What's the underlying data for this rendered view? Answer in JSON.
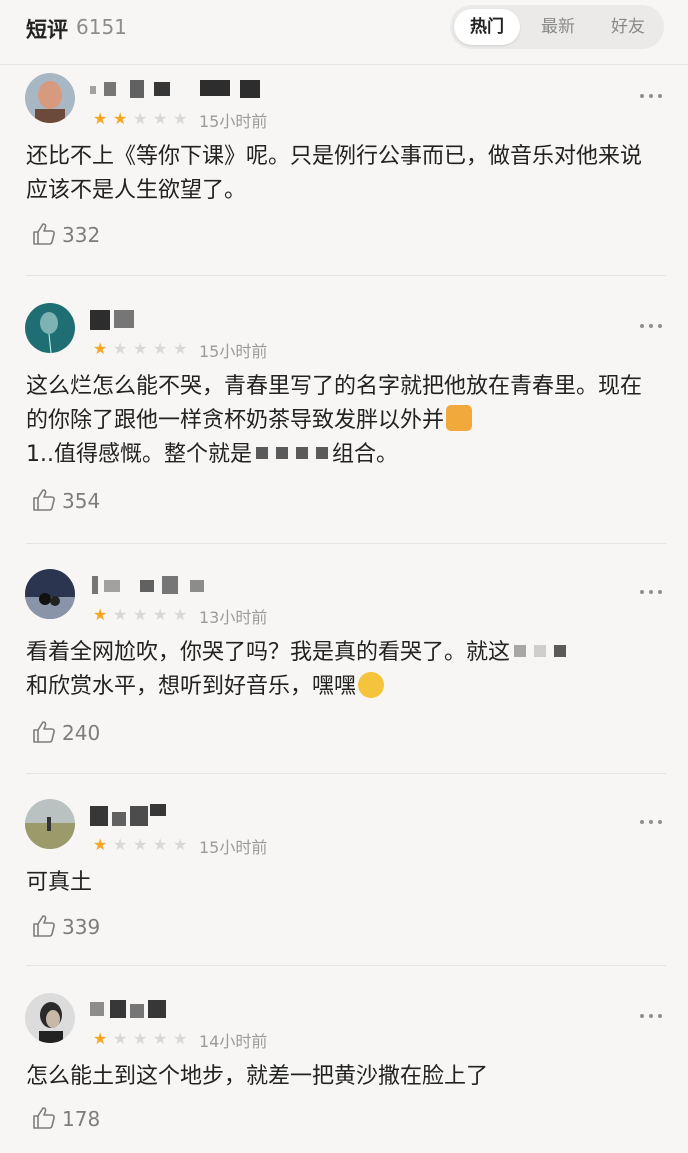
{
  "header": {
    "title": "短评",
    "count": "6151",
    "tabs": [
      {
        "label": "热门",
        "active": true
      },
      {
        "label": "最新",
        "active": false
      },
      {
        "label": "好友",
        "active": false
      }
    ]
  },
  "colors": {
    "star_filled": "#f5a623",
    "star_empty": "#d8d8d8",
    "background": "#f7f6f4"
  },
  "comments": [
    {
      "rating": 2,
      "time": "15小时前",
      "text": "还比不上《等你下课》呢。只是例行公事而已，做音乐对他来说应该不是人生欲望了。",
      "likes": "332"
    },
    {
      "rating": 1,
      "time": "15小时前",
      "text_1": "这么烂怎么能不哭，青春里写了的名字就把他放在青春里。现在的你除了跟他一样贪杯奶茶导致发胖以外并",
      "text_2": "1..值得感慨。整个就是",
      "text_3": "组合。",
      "likes": "354"
    },
    {
      "rating": 1,
      "time": "13小时前",
      "text_1": "看着全网尬吹，你哭了吗？我是真的看哭了。就这",
      "text_2": "和欣赏水平，想听到好音乐，嘿嘿",
      "likes": "240"
    },
    {
      "rating": 1,
      "time": "15小时前",
      "text": "可真土",
      "likes": "339"
    },
    {
      "rating": 1,
      "time": "14小时前",
      "text": "怎么能土到这个地步，就差一把黄沙撒在脸上了",
      "likes": "178"
    }
  ]
}
